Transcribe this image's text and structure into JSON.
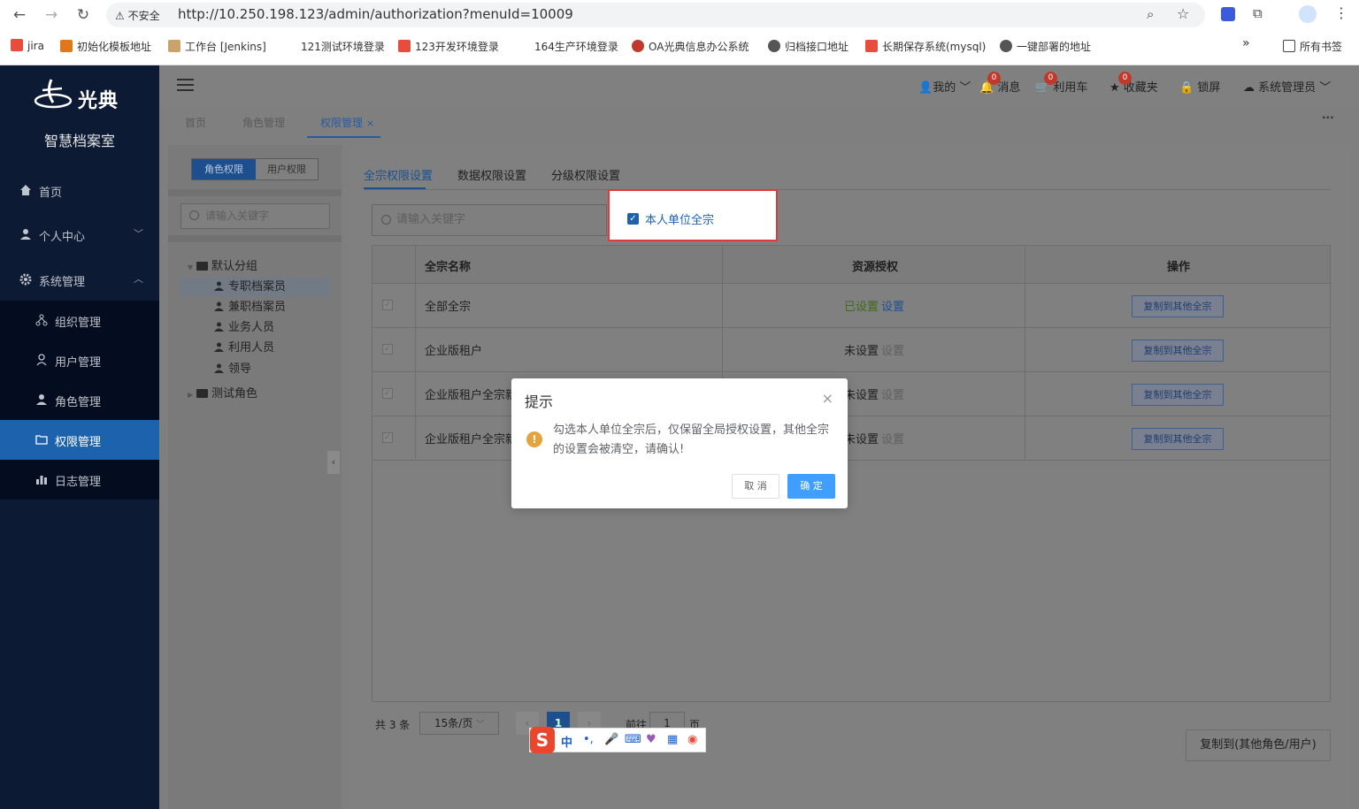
{
  "browser": {
    "security_label": "不安全",
    "url": "http://10.250.198.123/admin/authorization?menuId=10009",
    "bookmarks": [
      "jira",
      "初始化模板地址",
      "工作台 [Jenkins]",
      "121测试环境登录",
      "123开发环境登录",
      "164生产环境登录",
      "OA光典信息办公系统",
      "归档接口地址",
      "长期保存系统(mysql)",
      "一键部署的地址"
    ],
    "more_label": "»",
    "all_bookmarks": "所有书签"
  },
  "sidebar": {
    "logo_text": "光典",
    "system_name": "智慧档案室",
    "items": [
      {
        "label": "首页"
      },
      {
        "label": "个人中心"
      },
      {
        "label": "系统管理"
      },
      {
        "label": "组织管理"
      },
      {
        "label": "用户管理"
      },
      {
        "label": "角色管理"
      },
      {
        "label": "权限管理"
      },
      {
        "label": "日志管理"
      }
    ]
  },
  "header": {
    "mine": "我的",
    "messages": "消息",
    "messages_count": "0",
    "cart": "利用车",
    "cart_count": "0",
    "favorites": "收藏夹",
    "favorites_count": "0",
    "lock": "锁屏",
    "user": "系统管理员",
    "more": "···"
  },
  "tabs": [
    "首页",
    "角色管理",
    "权限管理"
  ],
  "left_panel": {
    "seg_role": "角色权限",
    "seg_user": "用户权限",
    "search_placeholder": "请输入关键字",
    "tree": {
      "group1": "默认分组",
      "children": [
        "专职档案员",
        "兼职档案员",
        "业务人员",
        "利用人员",
        "领导"
      ],
      "group2": "测试角色"
    }
  },
  "right_panel": {
    "tabs": [
      "全宗权限设置",
      "数据权限设置",
      "分级权限设置"
    ],
    "search_placeholder": "请输入关键字",
    "checkbox_label": "本人单位全宗",
    "columns": [
      "全宗名称",
      "资源授权",
      "操作"
    ],
    "rows": [
      {
        "name": "全部全宗",
        "status": "已设置",
        "action": "设置",
        "copy": "复制到其他全宗"
      },
      {
        "name": "企业版租户",
        "status": "未设置",
        "action": "设置",
        "copy": "复制到其他全宗"
      },
      {
        "name": "企业版租户全宗新",
        "status": "未设置",
        "action": "设置",
        "copy": "复制到其他全宗"
      },
      {
        "name": "企业版租户全宗新",
        "status": "未设置",
        "action": "设置",
        "copy": "复制到其他全宗"
      }
    ],
    "pager": {
      "total": "共 3 条",
      "page_size": "15条/页",
      "current": "1",
      "goto": "前往",
      "goto_value": "1",
      "page_unit": "页"
    },
    "copy_big": "复制到(其他角色/用户)"
  },
  "dialog": {
    "title": "提示",
    "message": "勾选本人单位全宗后，仅保留全局授权设置，其他全宗的设置会被清空，请确认!",
    "cancel": "取 消",
    "ok": "确 定"
  },
  "ime": {
    "lang": "中"
  },
  "colors": {
    "sidebar": "#0d1a33",
    "active": "#1d62ad",
    "primary": "#409eff",
    "warning": "#e6a23c",
    "highlight_box": "#e4393c"
  }
}
